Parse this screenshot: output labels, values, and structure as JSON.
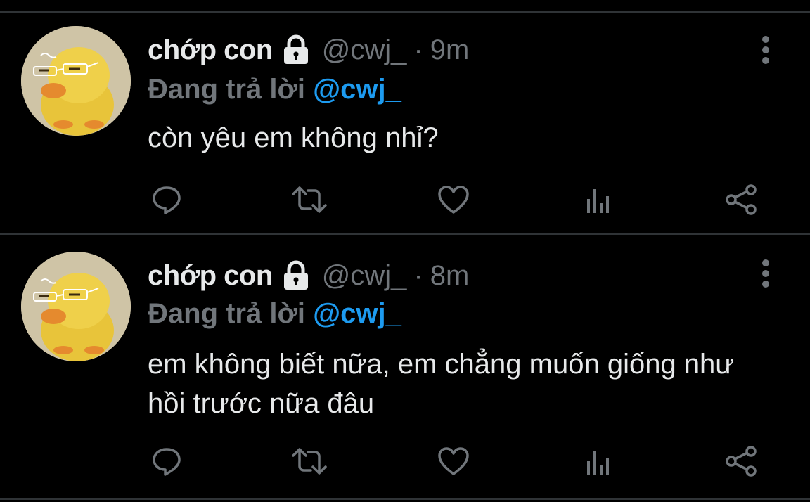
{
  "colors": {
    "background": "#000000",
    "text_primary": "#e7e9ea",
    "text_secondary": "#71767b",
    "link": "#1d9bf0",
    "divider": "#2f3336"
  },
  "tweets": [
    {
      "display_name": "chớp con",
      "handle": "@cwj_",
      "separator": "·",
      "time": "9m",
      "reply_prefix": "Đang trả lời",
      "reply_to": "@cwj_",
      "text": "còn yêu em không nhỉ?",
      "icons": [
        "lock-icon",
        "more-icon",
        "reply-icon",
        "retweet-icon",
        "like-icon",
        "views-icon",
        "share-icon"
      ]
    },
    {
      "display_name": "chớp con",
      "handle": "@cwj_",
      "separator": "·",
      "time": "8m",
      "reply_prefix": "Đang trả lời",
      "reply_to": "@cwj_",
      "text": "em không biết nữa, em chẳng muốn giống như hồi trước nữa đâu",
      "icons": [
        "lock-icon",
        "more-icon",
        "reply-icon",
        "retweet-icon",
        "like-icon",
        "views-icon",
        "share-icon"
      ]
    }
  ]
}
